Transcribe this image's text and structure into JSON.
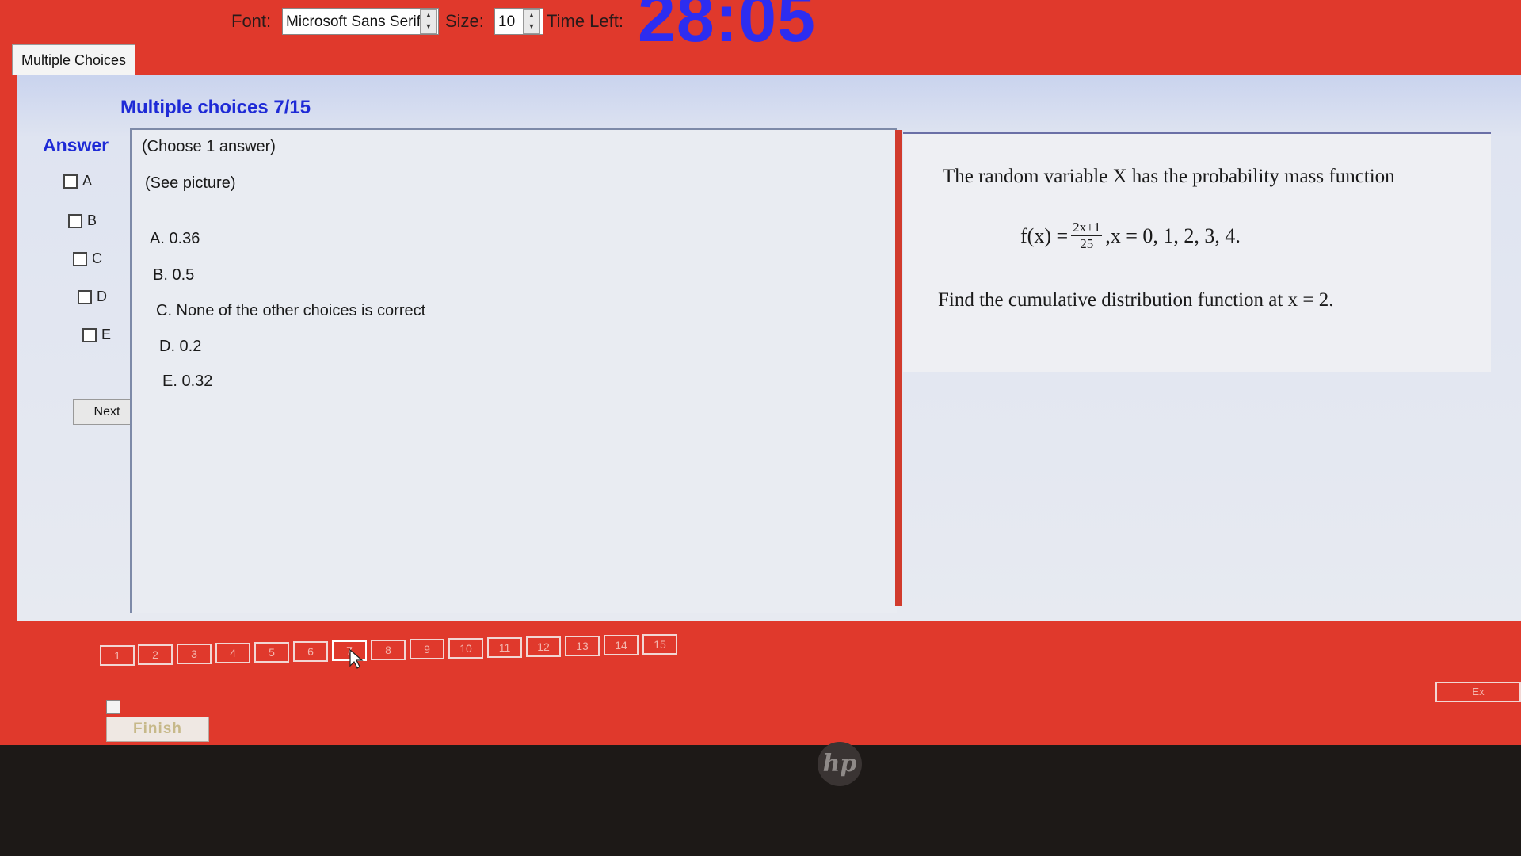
{
  "toolbar": {
    "font_label": "Font:",
    "font_value": "Microsoft Sans Serif",
    "size_label": "Size:",
    "size_value": "10",
    "time_label": "Time Left:",
    "time_value": "28:05"
  },
  "tab": {
    "label": "Multiple Choices"
  },
  "main": {
    "heading": "Multiple choices 7/15",
    "answer_title": "Answer",
    "answer_options": [
      "A",
      "B",
      "C",
      "D",
      "E"
    ],
    "next_label": "Next"
  },
  "choices": {
    "instruction": "(Choose 1 answer)",
    "note": "(See picture)",
    "items": [
      "A. 0.36",
      "B. 0.5",
      "C. None of the other choices is correct",
      "D. 0.2",
      "E. 0.32"
    ]
  },
  "question": {
    "line1": "The random variable X has the probability mass function",
    "formula_lhs": "f(x) =",
    "formula_num": "2x+1",
    "formula_den": "25",
    "formula_rhs": ",x = 0,  1,  2,  3,  4.",
    "line3": "Find the cumulative distribution function at x = 2."
  },
  "pagination": {
    "pages": [
      "1",
      "2",
      "3",
      "4",
      "5",
      "6",
      "7",
      "8",
      "9",
      "10",
      "11",
      "12",
      "13",
      "14",
      "15"
    ],
    "current": "7"
  },
  "footer": {
    "finish_label": "Finish",
    "right_button_label": "Ex"
  },
  "colors": {
    "screen_bg": "#e0392c",
    "accent_blue": "#1e2ad6",
    "timer": "#2d2df0"
  },
  "icons": {
    "spin": "spin-up-down-icon",
    "brand": "hp-logo-icon",
    "cursor": "mouse-pointer-icon"
  }
}
